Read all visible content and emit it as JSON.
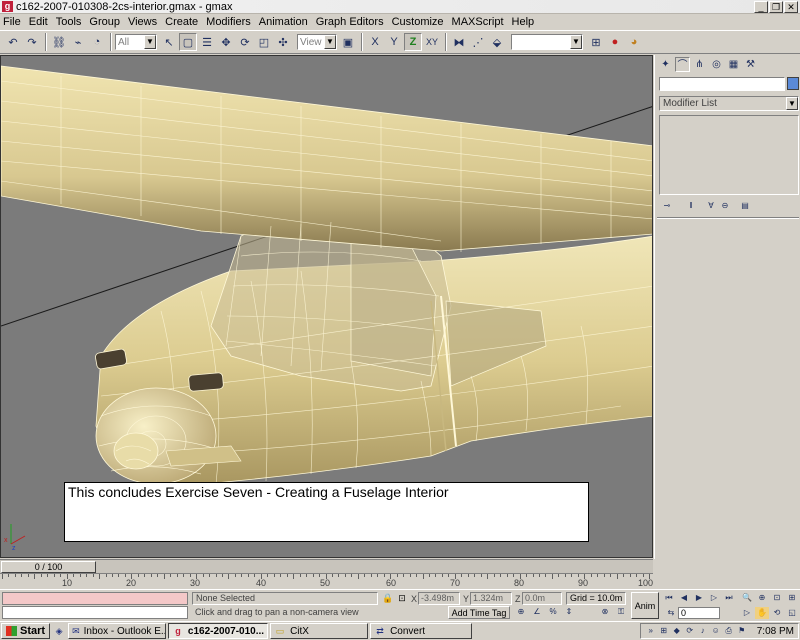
{
  "window": {
    "title": "c162-2007-010308-2cs-interior.gmax - gmax",
    "app_icon": "gmax-icon",
    "controls": [
      "_",
      "❐",
      "✕"
    ]
  },
  "menu": [
    "File",
    "Edit",
    "Tools",
    "Group",
    "Views",
    "Create",
    "Modifiers",
    "Animation",
    "Graph Editors",
    "Customize",
    "MAXScript",
    "Help"
  ],
  "toolbar": {
    "selection_filter": "All",
    "coord_system": "View",
    "constraint_z": "Z",
    "constraint_xy": "XY"
  },
  "viewport": {
    "caption": "This concludes Exercise Seven - Creating a Fuselage Interior",
    "wire_color": "#d8c888",
    "shade_color": "#e0d090",
    "bg_color": "#7b7b7b"
  },
  "command_panel": {
    "modifier_list": "Modifier List",
    "object_color": "#5a8ad8"
  },
  "time": {
    "slider_label": "0 / 100",
    "ticks": [
      "10",
      "20",
      "30",
      "40",
      "50",
      "60",
      "70",
      "80",
      "90",
      "100"
    ]
  },
  "status": {
    "selection": "None Selected",
    "prompt": "Click and drag to pan a non-camera view",
    "x_label": "X",
    "x_value": "-3.498m",
    "y_label": "Y",
    "y_value": "1.324m",
    "z_label": "Z",
    "z_value": "0.0m",
    "grid": "Grid = 10.0m",
    "add_time_tag": "Add Time Tag",
    "anim": "Anim",
    "frame": "0"
  },
  "taskbar": {
    "start": "Start",
    "tasks": [
      {
        "label": "Inbox - Outlook E...",
        "icon": "outlook-icon",
        "active": false
      },
      {
        "label": "c162-2007-010...",
        "icon": "gmax-icon",
        "active": true
      },
      {
        "label": "CitX",
        "icon": "folder-icon",
        "active": false
      },
      {
        "label": "Convert",
        "icon": "convert-icon",
        "active": false
      }
    ],
    "clock": "7:08 PM"
  }
}
